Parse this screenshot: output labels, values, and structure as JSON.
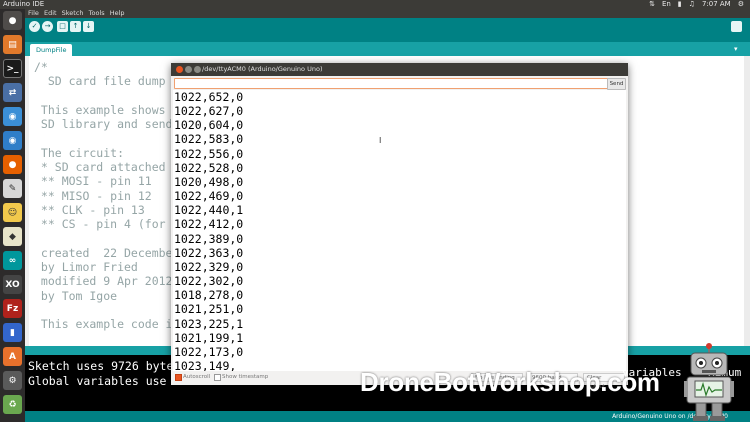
{
  "os": {
    "title": "Arduino IDE",
    "tray_time": "7:07 AM"
  },
  "menubar": {
    "items": [
      "File",
      "Edit",
      "Sketch",
      "Tools",
      "Help"
    ]
  },
  "tabs": {
    "active": "DumpFile"
  },
  "editor": {
    "code": "/*\n  SD card file dump\n\n This example shows h\n SD library and send\n\n The circuit:\n * SD card attached t\n ** MOSI - pin 11\n ** MISO - pin 12\n ** CLK - pin 13\n ** CS - pin 4 (for M\n\n created  22 December\n by Limor Fried\n modified 9 Apr 2012\n by Tom Igoe\n\n This example code is\n\n */"
  },
  "console": {
    "lines": "Sketch uses 9726 byte\nGlobal variables use "
  },
  "statusbar": {
    "board": "Arduino/Genuino Uno on /dev/ttyACM0"
  },
  "serial_monitor": {
    "title": "/dev/ttyACM0 (Arduino/Genuino Uno)",
    "input_value": "",
    "send_label": "Send",
    "output": "1022,652,0\n1022,627,0\n1020,604,0\n1022,583,0\n1022,556,0\n1022,528,0\n1020,498,0\n1022,469,0\n1022,440,1\n1022,412,0\n1022,389,0\n1022,363,0\n1022,329,0\n1022,302,0\n1018,278,0\n1021,251,0\n1023,225,1\n1021,199,1\n1022,173,0\n1023,149,",
    "autoscroll_label": "Autoscroll",
    "timestamp_label": "Show timestamp",
    "line_ending": "No line ending",
    "baud": "9600 baud",
    "clear_label": "Clear output"
  },
  "overlay": {
    "watermark": "DroneBotWorkshop.com",
    "console_tail": "variables    ximum"
  },
  "colors": {
    "teal": "#008184",
    "teal_light": "#17a1a5",
    "ubuntu_bar": "#3c3b37",
    "close_dot": "#e95420"
  }
}
